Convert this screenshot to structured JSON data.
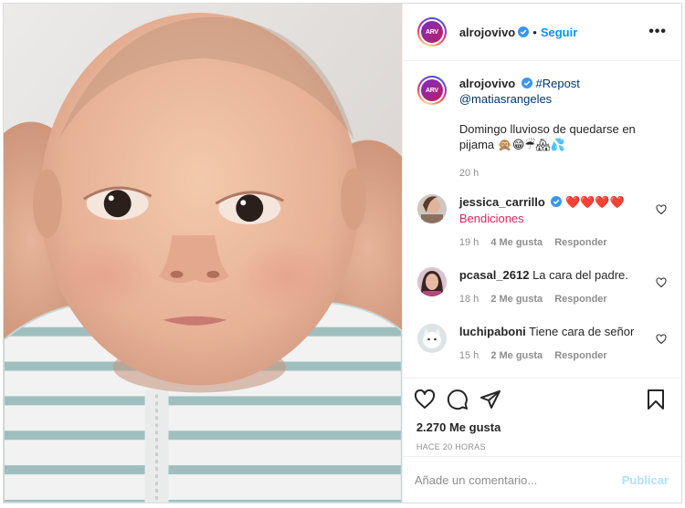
{
  "author": {
    "username": "alrojovivo",
    "avatar_text": "ARV",
    "verified": true,
    "follow_label": "Seguir",
    "separator": "•"
  },
  "caption": {
    "username": "alrojovivo",
    "hashtag": "#Repost",
    "mention": "@matiasrangeles",
    "text": "Domingo lluvioso de quedarse en pijama 🙊😁☔🏘💦",
    "time": "20 h"
  },
  "comments": [
    {
      "username": "jessica_carrillo",
      "verified": true,
      "text": "❤️❤️❤️❤️ Bendiciones",
      "time": "19 h",
      "likes": "4 Me gusta",
      "reply": "Responder"
    },
    {
      "username": "pcasal_2612",
      "verified": false,
      "text": "La cara del padre.",
      "time": "18 h",
      "likes": "2 Me gusta",
      "reply": "Responder"
    },
    {
      "username": "luchipaboni",
      "verified": false,
      "text": "Tiene cara de señor",
      "time": "15 h",
      "likes": "2 Me gusta",
      "reply": "Responder"
    }
  ],
  "stats": {
    "likes": "2.270 Me gusta",
    "ago": "HACE 20 HORAS"
  },
  "add_comment": {
    "placeholder": "Añade un comentario...",
    "publish_label": "Publicar"
  },
  "colors": {
    "link_blue": "#0095f6",
    "mention_blue": "#00376b",
    "muted": "#8e8e8e",
    "border": "#dbdbdb"
  },
  "icons": {
    "like": "heart-icon",
    "comment": "comment-icon",
    "share": "paper-plane-icon",
    "save": "bookmark-icon",
    "options": "ellipsis-icon",
    "verified": "verified-badge-icon"
  }
}
